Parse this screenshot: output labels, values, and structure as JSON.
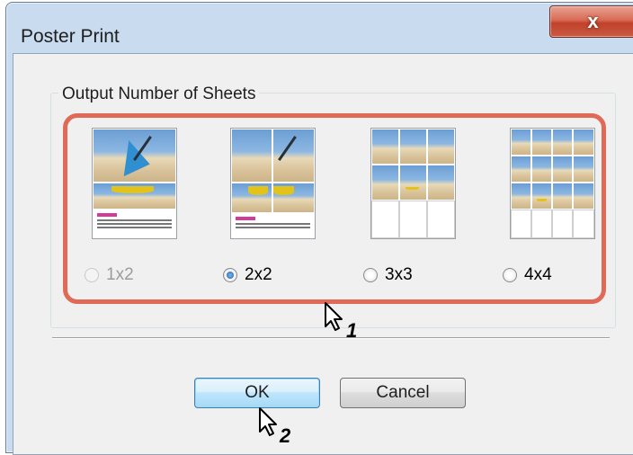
{
  "window": {
    "title": "Poster Print",
    "close_glyph": "x"
  },
  "group": {
    "label": "Output Number of Sheets",
    "options": [
      {
        "label": "1x2",
        "state": "disabled"
      },
      {
        "label": "2x2",
        "state": "selected"
      },
      {
        "label": "3x3",
        "state": "unselected"
      },
      {
        "label": "4x4",
        "state": "unselected"
      }
    ]
  },
  "buttons": {
    "ok": "OK",
    "cancel": "Cancel"
  },
  "callouts": {
    "first": "1",
    "second": "2"
  },
  "colors": {
    "highlight": "#e06a57",
    "close_button": "#c2412a",
    "accent": "#3c7fb1"
  }
}
